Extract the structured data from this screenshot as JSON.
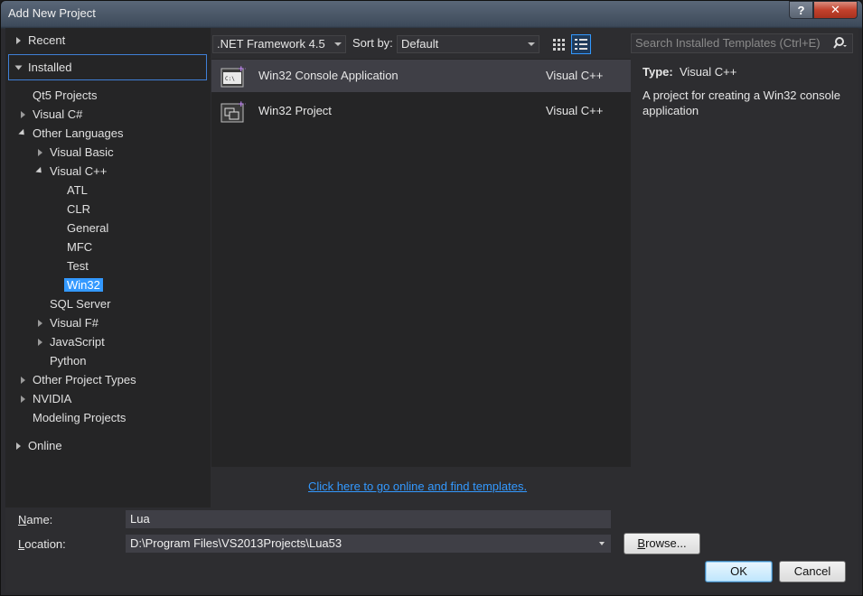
{
  "window": {
    "title": "Add New Project",
    "help_glyph": "?",
    "close_glyph": "✕"
  },
  "tree": {
    "recent": "Recent",
    "installed": "Installed",
    "qt5": "Qt5 Projects",
    "visual_csharp": "Visual C#",
    "other_languages": "Other Languages",
    "visual_basic": "Visual Basic",
    "visual_cpp": "Visual C++",
    "atl": "ATL",
    "clr": "CLR",
    "general": "General",
    "mfc": "MFC",
    "test": "Test",
    "win32": "Win32",
    "sql_server": "SQL Server",
    "visual_fsharp": "Visual F#",
    "javascript": "JavaScript",
    "python": "Python",
    "other_project_types": "Other Project Types",
    "nvidia": "NVIDIA",
    "modeling_projects": "Modeling Projects",
    "online": "Online"
  },
  "toolbar": {
    "framework": ".NET Framework 4.5",
    "sort_by_label": "Sort by:",
    "sort_value": "Default"
  },
  "templates": [
    {
      "name": "Win32 Console Application",
      "lang": "Visual C++",
      "icon": "console-app-icon"
    },
    {
      "name": "Win32 Project",
      "lang": "Visual C++",
      "icon": "win32-project-icon"
    }
  ],
  "online_link": "Click here to go online and find templates.",
  "search": {
    "placeholder": "Search Installed Templates (Ctrl+E)"
  },
  "details": {
    "type_label": "Type:",
    "type_value": "Visual C++",
    "description": "A project for creating a Win32 console application"
  },
  "form": {
    "name_label_pre": "",
    "name_label_key": "N",
    "name_label_post": "ame:",
    "name_value": "Lua",
    "location_label_key": "L",
    "location_label_post": "ocation:",
    "location_value": "D:\\Program Files\\VS2013Projects\\Lua53",
    "browse_key": "B",
    "browse_post": "rowse...",
    "ok": "OK",
    "cancel": "Cancel"
  },
  "colors": {
    "accent": "#3399ff",
    "selection": "#3399ff",
    "row_selected": "#3f3f46"
  }
}
